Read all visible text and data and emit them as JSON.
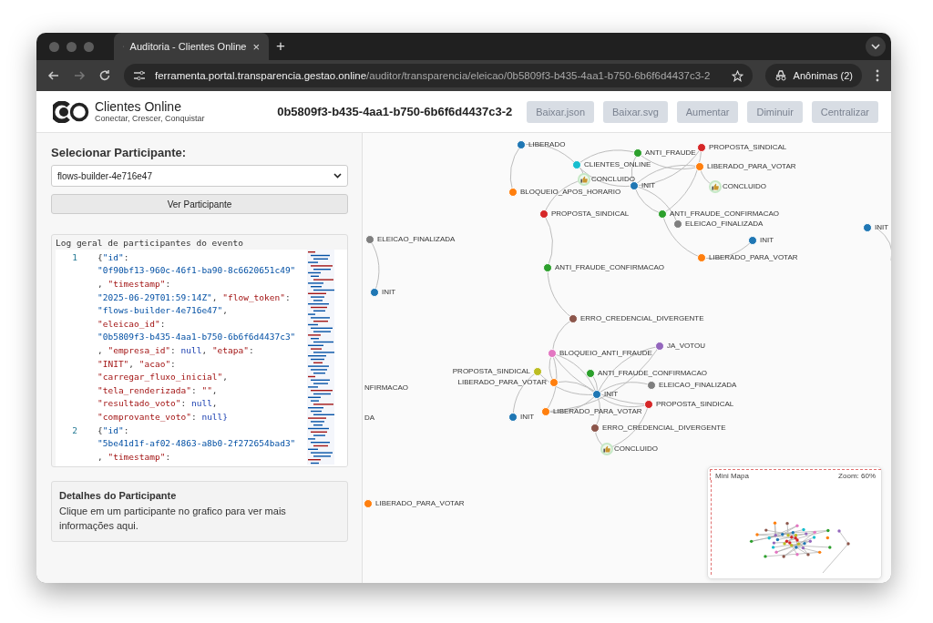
{
  "browser": {
    "tab": {
      "title": "Auditoria - Clientes Online",
      "close": "×"
    },
    "new_tab": "+",
    "url_domain": "ferramenta.portal.transparencia.gestao.online",
    "url_path": "/auditor/transparencia/eleicao/0b5809f3-b435-4aa1-b750-6b6f6d4437c3-2",
    "profile": "Anônimas (2)"
  },
  "header": {
    "brand": "Clientes Online",
    "tagline": "Conectar, Crescer, Conquistar",
    "title": "0b5809f3-b435-4aa1-b750-6b6f6d4437c3-2",
    "buttons": [
      "Baixar.json",
      "Baixar.svg",
      "Aumentar",
      "Diminuir",
      "Centralizar"
    ]
  },
  "sidebar": {
    "select_label": "Selecionar Participante:",
    "select_value": "flows-builder-4e716e47",
    "view_button": "Ver Participante",
    "log": {
      "title": "Log geral de participantes do evento",
      "entries": [
        {
          "number": "1",
          "lines": [
            [
              {
                "text": "{",
                "kind": "plain"
              },
              {
                "text": "\"id\"",
                "kind": "string"
              },
              {
                "text": ":",
                "kind": "plain"
              }
            ],
            [
              {
                "text": "\"0f90bf13-960c-46f1-ba90-8c6620651c49\"",
                "kind": "string"
              }
            ],
            [
              {
                "text": ", ",
                "kind": "plain"
              },
              {
                "text": "\"timestamp\"",
                "kind": "key"
              },
              {
                "text": ":",
                "kind": "plain"
              }
            ],
            [
              {
                "text": "\"2025-06-29T01:59:14Z\"",
                "kind": "string"
              },
              {
                "text": ", ",
                "kind": "plain"
              },
              {
                "text": "\"flow_token\"",
                "kind": "key"
              },
              {
                "text": ":",
                "kind": "plain"
              }
            ],
            [
              {
                "text": "\"flows-builder-4e716e47\"",
                "kind": "string"
              },
              {
                "text": ",",
                "kind": "plain"
              }
            ],
            [
              {
                "text": "\"eleicao_id\"",
                "kind": "key"
              },
              {
                "text": ":",
                "kind": "plain"
              }
            ],
            [
              {
                "text": "\"0b5809f3-b435-4aa1-b750-6b6f6d4437c3\"",
                "kind": "string"
              }
            ],
            [
              {
                "text": ", ",
                "kind": "plain"
              },
              {
                "text": "\"empresa_id\"",
                "kind": "key"
              },
              {
                "text": ": ",
                "kind": "plain"
              },
              {
                "text": "null",
                "kind": "literal"
              },
              {
                "text": ", ",
                "kind": "plain"
              },
              {
                "text": "\"etapa\"",
                "kind": "key"
              },
              {
                "text": ":",
                "kind": "plain"
              }
            ],
            [
              {
                "text": "\"INIT\"",
                "kind": "key"
              },
              {
                "text": ", ",
                "kind": "plain"
              },
              {
                "text": "\"acao\"",
                "kind": "key"
              },
              {
                "text": ":",
                "kind": "plain"
              }
            ],
            [
              {
                "text": "\"carregar_fluxo_inicial\"",
                "kind": "key"
              },
              {
                "text": ",",
                "kind": "plain"
              }
            ],
            [
              {
                "text": "\"tela_renderizada\"",
                "kind": "key"
              },
              {
                "text": ": ",
                "kind": "plain"
              },
              {
                "text": "\"\"",
                "kind": "key"
              },
              {
                "text": ",",
                "kind": "plain"
              }
            ],
            [
              {
                "text": "\"resultado_voto\"",
                "kind": "key"
              },
              {
                "text": ": ",
                "kind": "plain"
              },
              {
                "text": "null",
                "kind": "literal"
              },
              {
                "text": ",",
                "kind": "plain"
              }
            ],
            [
              {
                "text": "\"comprovante_voto\"",
                "kind": "key"
              },
              {
                "text": ": ",
                "kind": "plain"
              },
              {
                "text": "null",
                "kind": "literal"
              },
              {
                "text": "}",
                "kind": "literal"
              }
            ]
          ]
        },
        {
          "number": "2",
          "lines": [
            [
              {
                "text": "{",
                "kind": "plain"
              },
              {
                "text": "\"id\"",
                "kind": "string"
              },
              {
                "text": ":",
                "kind": "plain"
              }
            ],
            [
              {
                "text": "\"5be41d1f-af02-4863-a8b0-2f272654bad3\"",
                "kind": "string"
              }
            ],
            [
              {
                "text": ", ",
                "kind": "plain"
              },
              {
                "text": "\"timestamp\"",
                "kind": "key"
              },
              {
                "text": ":",
                "kind": "plain"
              }
            ]
          ]
        }
      ]
    },
    "details": {
      "title": "Detalhes do Participante",
      "text": "Clique em um participante no grafico para ver mais informações aqui."
    }
  },
  "graph": {
    "nodes": [
      {
        "kind": "dot",
        "label": "LIBERADO",
        "color": "#1f77b4"
      },
      {
        "kind": "dot",
        "label": "CLIENTES_ONLINE",
        "color": "#17becf"
      },
      {
        "kind": "done",
        "label": "CONCLUIDO"
      },
      {
        "kind": "dot",
        "label": "BLOQUEIO_APOS_HORARIO",
        "color": "#ff7f0e"
      },
      {
        "kind": "dot",
        "label": "ANTI_FRAUDE",
        "color": "#2ca02c"
      },
      {
        "kind": "dot",
        "label": "PROPOSTA_SINDICAL",
        "color": "#d62728"
      },
      {
        "kind": "dot",
        "label": "LIBERADO_PARA_VOTAR",
        "color": "#ff7f0e"
      },
      {
        "kind": "dot",
        "label": "INIT",
        "color": "#1f77b4"
      },
      {
        "kind": "done",
        "label": "CONCLUIDO"
      },
      {
        "kind": "dot",
        "label": "PROPOSTA_SINDICAL",
        "color": "#d62728"
      },
      {
        "kind": "dot",
        "label": "ANTI_FRAUDE_CONFIRMACAO",
        "color": "#2ca02c"
      },
      {
        "kind": "dot",
        "label": "ELEICAO_FINALIZADA",
        "color": "#7f7f7f"
      },
      {
        "kind": "dot",
        "label": "LIBERADO_PARA_VOTAR",
        "color": "#ff7f0e"
      },
      {
        "kind": "dot",
        "label": "INIT",
        "color": "#1f77b4"
      },
      {
        "kind": "dot",
        "label": "INIT",
        "color": "#1f77b4"
      },
      {
        "kind": "dot",
        "label": "ELEICAO_FINALIZADA",
        "color": "#7f7f7f"
      },
      {
        "kind": "dot",
        "label": "INIT",
        "color": "#1f77b4"
      },
      {
        "kind": "dot",
        "label": "ANTI_FRAUDE_CONFIRMACAO",
        "color": "#2ca02c"
      },
      {
        "kind": "dot",
        "label": "ERRO_CREDENCIAL_DIVERGENTE",
        "color": "#8c564b"
      },
      {
        "kind": "dot",
        "label": "BLOQUEIO_ANTI_FRAUDE",
        "color": "#e377c2"
      },
      {
        "kind": "dot",
        "label": "JA_VOTOU",
        "color": "#9467bd"
      },
      {
        "kind": "dot",
        "label": "PROPOSTA_SINDICAL",
        "color": "#bcbd22"
      },
      {
        "kind": "dot",
        "label": "LIBERADO_PARA_VOTAR",
        "color": "#ff7f0e"
      },
      {
        "kind": "dot",
        "label": "ANTI_FRAUDE_CONFIRMACAO",
        "color": "#2ca02c"
      },
      {
        "kind": "dot",
        "label": "ELEICAO_FINALIZADA",
        "color": "#7f7f7f"
      },
      {
        "kind": "dot",
        "label": "INIT",
        "color": "#1f77b4"
      },
      {
        "kind": "dot",
        "label": "PROPOSTA_SINDICAL",
        "color": "#d62728"
      },
      {
        "kind": "dot",
        "label": "LIBERADO_PARA_VOTAR",
        "color": "#ff7f0e"
      },
      {
        "kind": "dot",
        "label": "INIT",
        "color": "#1f77b4"
      },
      {
        "kind": "dot",
        "label": "ERRO_CREDENCIAL_DIVERGENTE",
        "color": "#8c564b"
      },
      {
        "kind": "done",
        "label": "CONCLUIDO"
      },
      {
        "kind": "label",
        "label": "NFIRMACAO"
      },
      {
        "kind": "label",
        "label": "DA"
      },
      {
        "kind": "dot",
        "label": "LIBERADO_PARA_VOTAR",
        "color": "#ff7f0e"
      }
    ],
    "minimap": {
      "title": "Mini Mapa",
      "zoom": "Zoom: 60%"
    }
  }
}
